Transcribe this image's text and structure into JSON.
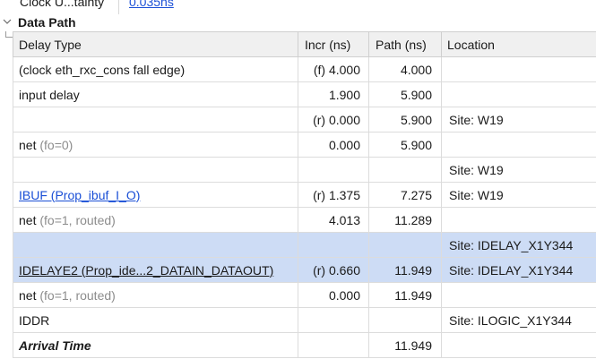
{
  "top_row": {
    "label": "Clock U...tainty",
    "value": "0.035ns"
  },
  "section": {
    "title": "Data Path"
  },
  "table": {
    "headers": [
      "Delay Type",
      "Incr (ns)",
      "Path (ns)",
      "Location"
    ],
    "rows": [
      {
        "delay_type": "(clock eth_rxc_cons fall edge)",
        "note": "",
        "incr": "(f) 4.000",
        "path": "4.000",
        "location": ""
      },
      {
        "delay_type": "input delay",
        "note": "",
        "incr": "1.900",
        "path": "5.900",
        "location": ""
      },
      {
        "delay_type": "",
        "note": "",
        "incr": "(r) 0.000",
        "path": "5.900",
        "location": "Site: W19"
      },
      {
        "delay_type": "net",
        "note": "(fo=0)",
        "incr": "0.000",
        "path": "5.900",
        "location": ""
      },
      {
        "delay_type": "",
        "note": "",
        "incr": "",
        "path": "",
        "location": "Site: W19"
      },
      {
        "delay_type": "IBUF (Prop_ibuf_I_O)",
        "note": "",
        "incr": "(r) 1.375",
        "path": "7.275",
        "location": "Site: W19"
      },
      {
        "delay_type": "net",
        "note": "(fo=1, routed)",
        "incr": "4.013",
        "path": "11.289",
        "location": ""
      },
      {
        "delay_type": "",
        "note": "",
        "incr": "",
        "path": "",
        "location": "Site: IDELAY_X1Y344"
      },
      {
        "delay_type": "IDELAYE2 (Prop_ide...2_DATAIN_DATAOUT)",
        "note": "",
        "incr": "(r) 0.660",
        "path": "11.949",
        "location": "Site: IDELAY_X1Y344"
      },
      {
        "delay_type": "net",
        "note": "(fo=1, routed)",
        "incr": "0.000",
        "path": "11.949",
        "location": ""
      },
      {
        "delay_type": "IDDR",
        "note": "",
        "incr": "",
        "path": "",
        "location": "Site: ILOGIC_X1Y344"
      },
      {
        "delay_type": "Arrival Time",
        "note": "",
        "incr": "",
        "path": "11.949",
        "location": ""
      }
    ]
  },
  "colors": {
    "link": "#1a4fd6",
    "selection": "#cddcf5",
    "header_bg": "#f0f0f0",
    "note_gray": "#8c8c8c"
  },
  "icons": {
    "section_toggle": "chevron-down-icon"
  }
}
